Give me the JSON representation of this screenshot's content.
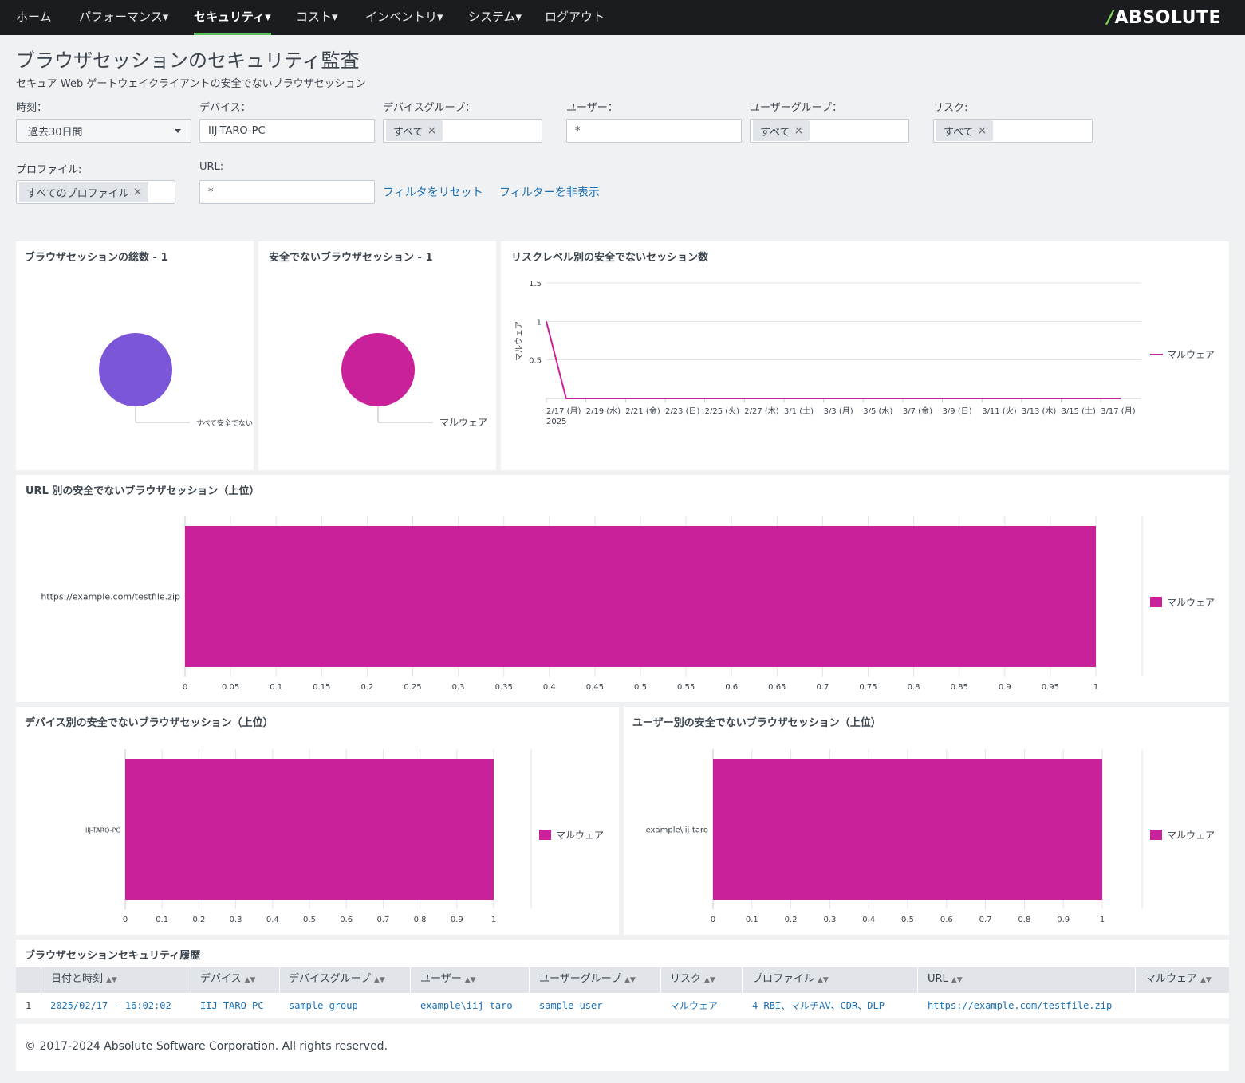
{
  "nav": {
    "items": [
      "ホーム",
      "パフォーマンス▾",
      "セキュリティ▾",
      "コスト▾",
      "インベントリ▾",
      "システム▾",
      "ログアウト"
    ],
    "active_index": 2,
    "brand_text": "ABSOLUTE",
    "brand_mark": "/",
    "accent_color": "#5cc05c"
  },
  "header": {
    "title": "ブラウザセッションのセキュリティ監査",
    "subtitle": "セキュア Web ゲートウェイクライアントの安全でないブラウザセッション"
  },
  "filters": {
    "time_label": "時刻：",
    "time_value": "過去30日間",
    "device_label": "デバイス：",
    "device_value": "IIJ-TARO-PC",
    "device_group_label": "デバイスグループ：",
    "device_group_token": "すべて",
    "user_label": "ユーザー：",
    "user_value": "*",
    "user_group_label": "ユーザーグループ：",
    "user_group_token": "すべて",
    "risk_label": "リスク:",
    "risk_token": "すべて",
    "profile_label": "プロファイル:",
    "profile_token": "すべてのプロファイル",
    "url_label": "URL:",
    "url_value": "*",
    "reset_link": "フィルタをリセット",
    "hide_link": "フィルターを非表示",
    "token_remove": "×"
  },
  "panels": {
    "total_title": "ブラウザセッションの総数 - 1",
    "total_slice_label": "すべて安全でない",
    "total_color": "#7b56d8",
    "unsafe_title": "安全でないブラウザセッション - 1",
    "unsafe_slice_label": "マルウェア",
    "malware_color": "#c9219a",
    "risk_title": "リスクレベル別の安全でないセッション数",
    "url_title": "URL 別の安全でないブラウザセッション（上位）",
    "device_title": "デバイス別の安全でないブラウザセッション（上位）",
    "user_title": "ユーザー別の安全でないブラウザセッション（上位）"
  },
  "chart_data": [
    {
      "type": "pie",
      "categories": [
        "すべて安全でない"
      ],
      "values": [
        1
      ]
    },
    {
      "type": "pie",
      "categories": [
        "マルウェア"
      ],
      "values": [
        1
      ]
    },
    {
      "type": "line",
      "ylabel": "マルウェア",
      "legend": [
        "マルウェア"
      ],
      "legend_position": "right",
      "ylim": [
        0,
        1.5
      ],
      "yticks": [
        "0.5",
        "1",
        "1.5"
      ],
      "x_ticks": [
        "2/17 (月)",
        "2/19 (水)",
        "2/21 (金)",
        "2/23 (日)",
        "2/25 (火)",
        "2/27 (木)",
        "3/1 (土)",
        "3/3 (月)",
        "3/5 (水)",
        "3/7 (金)",
        "3/9 (日)",
        "3/11 (火)",
        "3/13 (木)",
        "3/15 (土)",
        "3/17 (月)"
      ],
      "x_year": "2025",
      "x": [
        "2025-02-17",
        "2025-02-18",
        "2025-02-19",
        "2025-02-20",
        "2025-02-21",
        "2025-02-22",
        "2025-02-23",
        "2025-02-24",
        "2025-02-25",
        "2025-02-26",
        "2025-02-27",
        "2025-02-28",
        "2025-03-01",
        "2025-03-02",
        "2025-03-03",
        "2025-03-04",
        "2025-03-05",
        "2025-03-06",
        "2025-03-07",
        "2025-03-08",
        "2025-03-09",
        "2025-03-10",
        "2025-03-11",
        "2025-03-12",
        "2025-03-13",
        "2025-03-14",
        "2025-03-15",
        "2025-03-16",
        "2025-03-17",
        "2025-03-18"
      ],
      "series": [
        {
          "name": "マルウェア",
          "values": [
            1,
            0,
            0,
            0,
            0,
            0,
            0,
            0,
            0,
            0,
            0,
            0,
            0,
            0,
            0,
            0,
            0,
            0,
            0,
            0,
            0,
            0,
            0,
            0,
            0,
            0,
            0,
            0,
            0,
            0
          ]
        }
      ]
    },
    {
      "type": "bar",
      "orientation": "horizontal",
      "categories": [
        "https://example.com/testfile.zip"
      ],
      "series": [
        {
          "name": "マルウェア",
          "values": [
            1
          ]
        }
      ],
      "xlim": [
        0,
        1
      ],
      "x_ticks": [
        "0",
        "0.05",
        "0.1",
        "0.15",
        "0.2",
        "0.25",
        "0.3",
        "0.35",
        "0.4",
        "0.45",
        "0.5",
        "0.55",
        "0.6",
        "0.65",
        "0.7",
        "0.75",
        "0.8",
        "0.85",
        "0.9",
        "0.95",
        "1"
      ],
      "legend_position": "right"
    },
    {
      "type": "bar",
      "orientation": "horizontal",
      "categories": [
        "IIJ-TARO-PC"
      ],
      "series": [
        {
          "name": "マルウェア",
          "values": [
            1
          ]
        }
      ],
      "xlim": [
        0,
        1
      ],
      "x_ticks": [
        "0",
        "0.1",
        "0.2",
        "0.3",
        "0.4",
        "0.5",
        "0.6",
        "0.7",
        "0.8",
        "0.9",
        "1"
      ],
      "legend_position": "right"
    },
    {
      "type": "bar",
      "orientation": "horizontal",
      "categories": [
        "example\\iij-taro"
      ],
      "series": [
        {
          "name": "マルウェア",
          "values": [
            1
          ]
        }
      ],
      "xlim": [
        0,
        1
      ],
      "x_ticks": [
        "0",
        "0.1",
        "0.2",
        "0.3",
        "0.4",
        "0.5",
        "0.6",
        "0.7",
        "0.8",
        "0.9",
        "1"
      ],
      "legend_position": "right"
    }
  ],
  "history": {
    "title": "ブラウザセッションセキュリティ履歴",
    "columns": [
      "日付と時刻",
      "デバイス",
      "デバイスグループ",
      "ユーザー",
      "ユーザーグループ",
      "リスク",
      "プロファイル",
      "URL",
      "マルウェア"
    ],
    "sort_icon": "sort-icon",
    "rows": [
      {
        "index": "1",
        "cells": [
          "2025/02/17 - 16:02:02",
          "IIJ-TARO-PC",
          "sample-group",
          "example\\iij-taro",
          "sample-user",
          "マルウェア",
          "4 RBI、マルチAV、CDR、DLP",
          "https://example.com/testfile.zip",
          ""
        ]
      }
    ]
  },
  "footer": {
    "copyright": "© 2017-2024 Absolute Software Corporation. All rights reserved."
  }
}
